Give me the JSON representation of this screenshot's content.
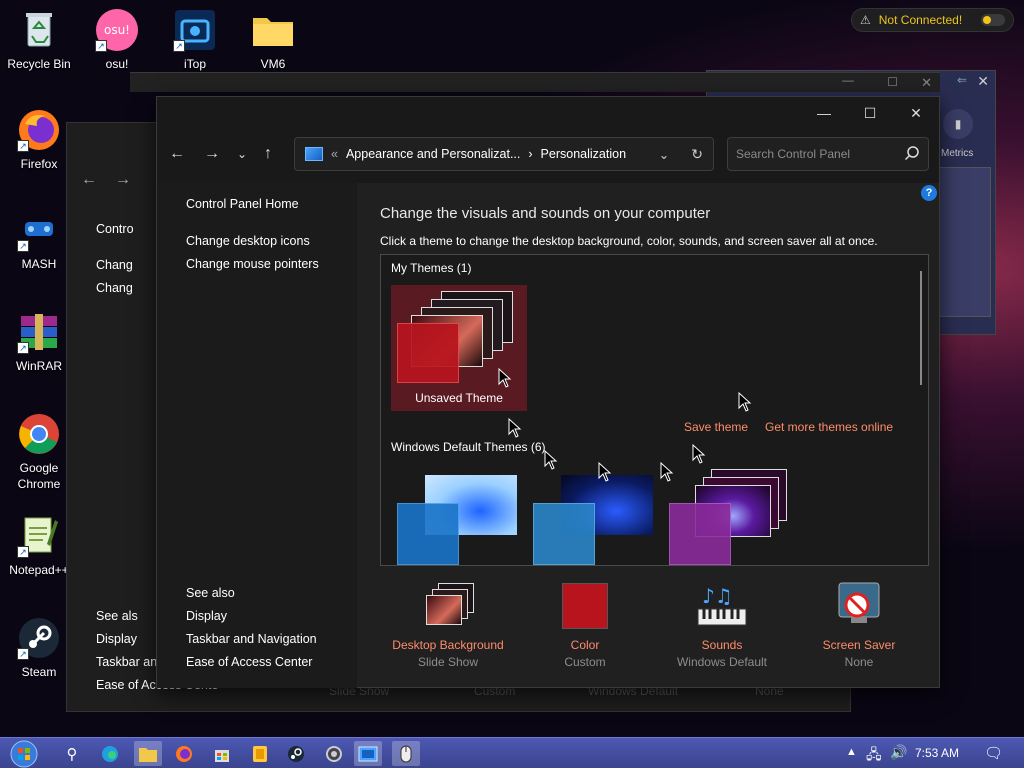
{
  "desktop": {
    "icons": [
      {
        "label": "Recycle Bin"
      },
      {
        "label": "osu!"
      },
      {
        "label": "iTop"
      },
      {
        "label": "VM6"
      },
      {
        "label": "Firefox"
      },
      {
        "label": "MASH"
      },
      {
        "label": "WinRAR"
      },
      {
        "label": "Google Chrome"
      },
      {
        "label": "Notepad++"
      },
      {
        "label": "Steam"
      }
    ]
  },
  "network": {
    "status": "Not Connected!"
  },
  "metrics_window": {
    "label": "Metrics"
  },
  "back_window": {
    "items": [
      "Contro",
      "Chang",
      "Chang"
    ],
    "see_also": [
      "See als",
      "Display",
      "Taskbar and",
      "Ease of Access Cente"
    ],
    "bottom_labels": [
      "Slide Show",
      "Custom",
      "Windows Default",
      "None"
    ]
  },
  "window": {
    "breadcrumb": {
      "prefix": "«",
      "parent": "Appearance and Personalizat...",
      "separator": "›",
      "current": "Personalization"
    },
    "search_placeholder": "Search Control Panel"
  },
  "sidebar": {
    "home": "Control Panel Home",
    "links": [
      "Change desktop icons",
      "Change mouse pointers"
    ],
    "see_also_heading": "See also",
    "see_also": [
      "Display",
      "Taskbar and Navigation",
      "Ease of Access Center"
    ]
  },
  "content": {
    "heading": "Change the visuals and sounds on your computer",
    "subheading": "Click a theme to change the desktop background, color, sounds, and screen saver all at once.",
    "help": "?",
    "my_themes_label": "My Themes (1)",
    "unsaved_theme": "Unsaved Theme",
    "save_theme": "Save theme",
    "get_more": "Get more themes online",
    "default_themes_label": "Windows Default Themes (6)"
  },
  "settings": [
    {
      "title": "Desktop Background",
      "value": "Slide Show"
    },
    {
      "title": "Color",
      "value": "Custom"
    },
    {
      "title": "Sounds",
      "value": "Windows Default"
    },
    {
      "title": "Screen Saver",
      "value": "None"
    }
  ],
  "taskbar": {
    "time": "7:53 AM"
  },
  "colors": {
    "accent_link": "#ff8c6a",
    "network_warning": "#f0c419",
    "taskbar": "#4d58b3"
  }
}
